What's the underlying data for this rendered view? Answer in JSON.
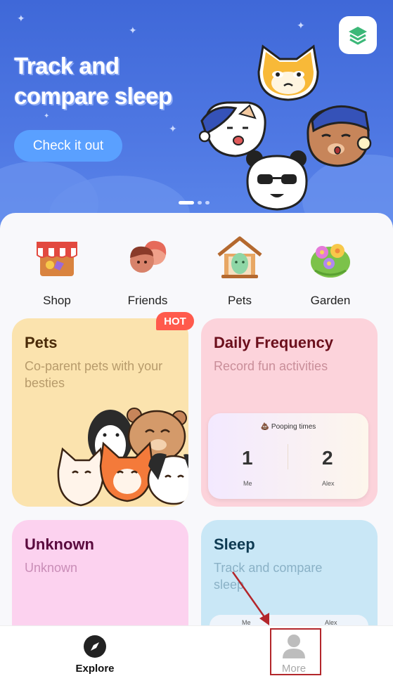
{
  "banner": {
    "title_line1": "Track and",
    "title_line2": "compare sleep",
    "cta_label": "Check it out",
    "layers_icon": "layers-icon",
    "carousel": {
      "count": 3,
      "active_index": 0
    }
  },
  "quick_links": [
    {
      "label": "Shop",
      "icon": "shop-icon"
    },
    {
      "label": "Friends",
      "icon": "friends-icon"
    },
    {
      "label": "Pets",
      "icon": "pet-egg-icon"
    },
    {
      "label": "Garden",
      "icon": "garden-icon"
    }
  ],
  "cards": {
    "pets": {
      "title": "Pets",
      "subtitle": "Co-parent pets with your besties",
      "badge": "HOT",
      "bg": "#fbe3ae",
      "title_color": "#4a2a08",
      "sub_color": "#b79b6b"
    },
    "daily": {
      "title": "Daily Frequency",
      "subtitle": "Record fun activities",
      "bg": "#fcd3db",
      "title_color": "#6b0f1c",
      "sub_color": "#c98e99",
      "widget": {
        "header": "💩 Pooping times",
        "left_value": "1",
        "left_name": "Me",
        "right_value": "2",
        "right_name": "Alex"
      }
    },
    "unknown": {
      "title": "Unknown",
      "subtitle": "Unknown",
      "bg": "#fcd2ef",
      "title_color": "#5a0a3e",
      "sub_color": "#c98db7"
    },
    "sleep": {
      "title": "Sleep",
      "subtitle": "Track and compare sleep",
      "bg": "#c9e7f6",
      "title_color": "#0e3a52",
      "sub_color": "#8ab1c6",
      "peek_left": "Me",
      "peek_right": "Alex"
    }
  },
  "nav": {
    "items": [
      {
        "label": "Explore",
        "icon": "compass-icon",
        "active": true
      },
      {
        "label": "More",
        "icon": "person-icon",
        "active": false
      }
    ]
  },
  "colors": {
    "accent": "#4f78e3",
    "cta": "#5aa0ff",
    "annotation": "#b3262b"
  }
}
